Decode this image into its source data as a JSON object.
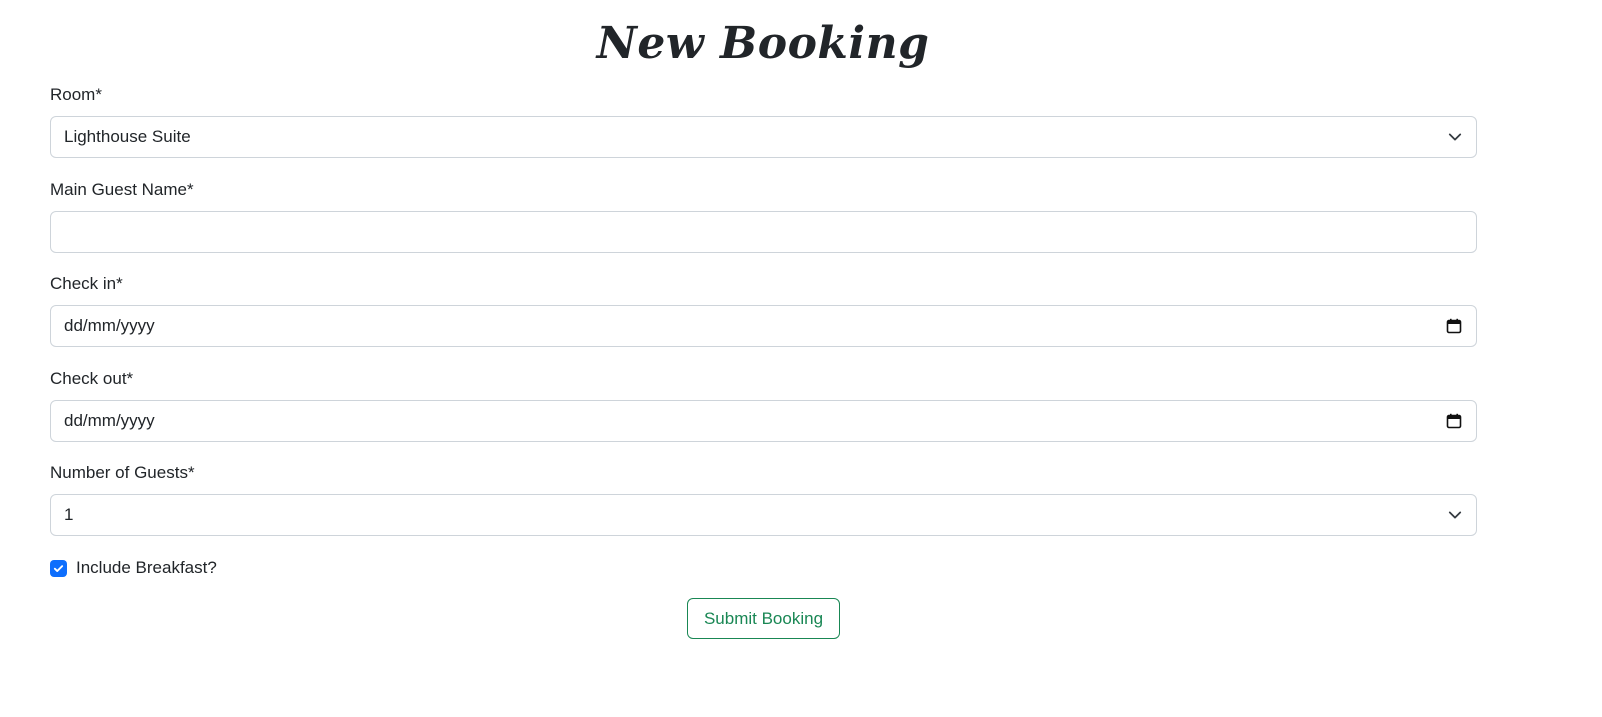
{
  "header": {
    "title": "New Booking"
  },
  "form": {
    "room": {
      "label": "Room*",
      "selected": "Lighthouse Suite"
    },
    "guest_name": {
      "label": "Main Guest Name*",
      "value": ""
    },
    "check_in": {
      "label": "Check in*",
      "placeholder": "dd/mm/yyyy"
    },
    "check_out": {
      "label": "Check out*",
      "placeholder": "dd/mm/yyyy"
    },
    "guests": {
      "label": "Number of Guests*",
      "selected": "1"
    },
    "breakfast": {
      "label": "Include Breakfast?",
      "checked": true
    },
    "submit_label": "Submit Booking"
  },
  "icons": {
    "select_arrow": "chevron-down-icon",
    "date_picker": "calendar-icon",
    "check": "checkmark-icon"
  },
  "colors": {
    "checkbox_accent": "#0d6efd",
    "submit_accent": "#198754",
    "border": "#ced4da",
    "text": "#212529"
  }
}
